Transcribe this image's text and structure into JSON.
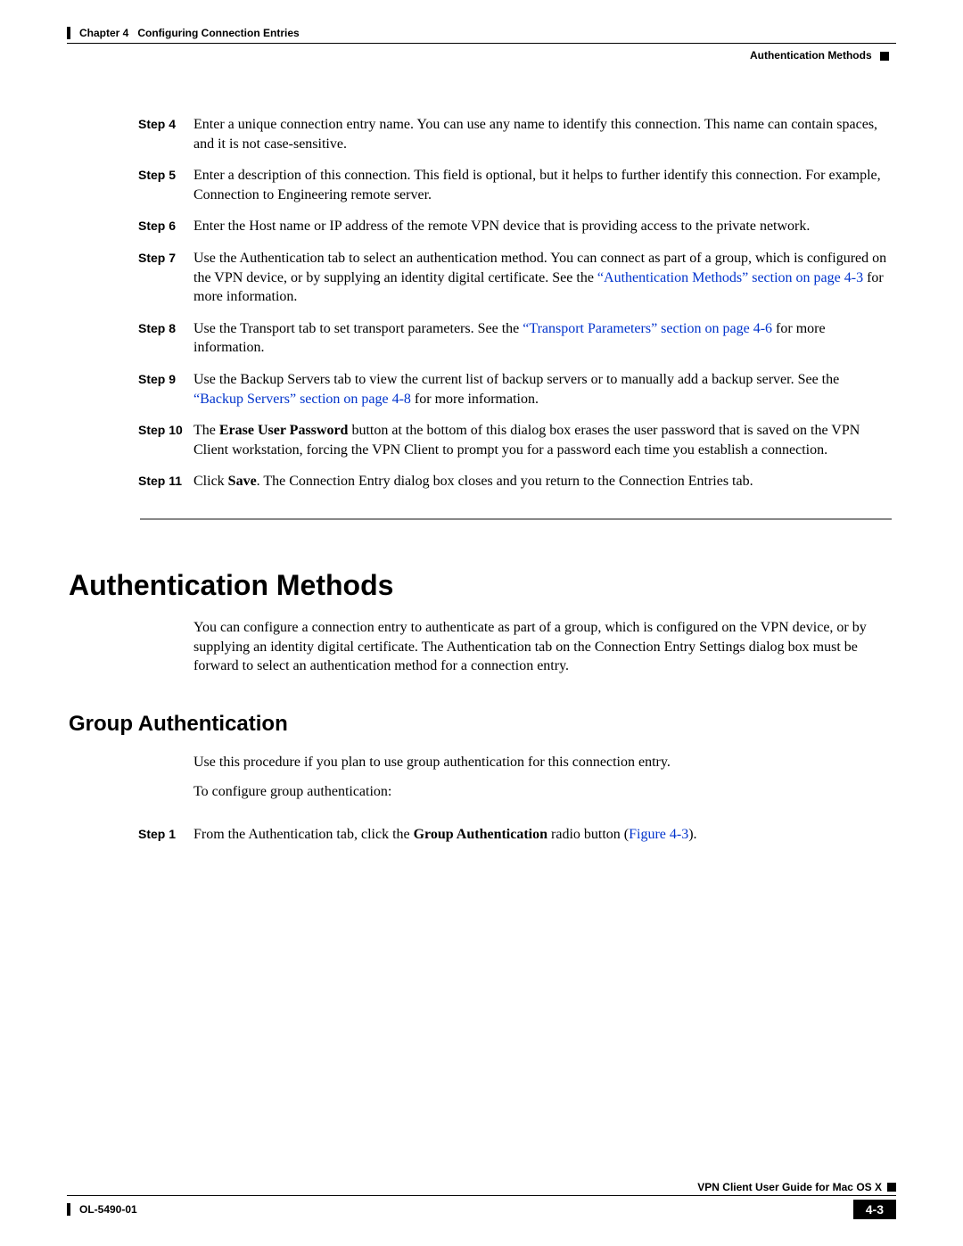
{
  "header": {
    "chapter": "Chapter 4",
    "title": "Configuring Connection Entries",
    "section": "Authentication Methods"
  },
  "steps_top": [
    {
      "label": "Step 4",
      "segments": [
        {
          "t": "Enter a unique connection entry name. You can use any name to identify this connection. This name can contain spaces, and it is not case-sensitive."
        }
      ]
    },
    {
      "label": "Step 5",
      "segments": [
        {
          "t": "Enter a description of this connection. This field is optional, but it helps to further identify this connection. For example, Connection to Engineering remote server."
        }
      ]
    },
    {
      "label": "Step 6",
      "segments": [
        {
          "t": "Enter the Host name or IP address of the remote VPN device that is providing access to the private network."
        }
      ]
    },
    {
      "label": "Step 7",
      "segments": [
        {
          "t": "Use the Authentication tab to select an authentication method. You can connect as part of a group, which is configured on the VPN device, or by supplying an identity digital certificate. See the "
        },
        {
          "t": "“Authentication Methods” section on page 4-3",
          "link": true
        },
        {
          "t": " for more information."
        }
      ]
    },
    {
      "label": "Step 8",
      "segments": [
        {
          "t": "Use the Transport tab to set transport parameters. See the "
        },
        {
          "t": "“Transport Parameters” section on page 4-6",
          "link": true
        },
        {
          "t": " for more information."
        }
      ]
    },
    {
      "label": "Step 9",
      "segments": [
        {
          "t": "Use the Backup Servers tab to view the current list of backup servers or to manually add a backup server. See the "
        },
        {
          "t": "“Backup Servers” section on page 4-8",
          "link": true
        },
        {
          "t": " for more information."
        }
      ]
    },
    {
      "label": "Step 10",
      "segments": [
        {
          "t": "The "
        },
        {
          "t": "Erase User Password",
          "bold": true
        },
        {
          "t": " button at the bottom of this dialog box erases the user password that is saved on the VPN Client workstation, forcing the VPN Client to prompt you for a password each time you establish a connection."
        }
      ]
    },
    {
      "label": "Step 11",
      "segments": [
        {
          "t": "Click "
        },
        {
          "t": "Save",
          "bold": true
        },
        {
          "t": ". The Connection Entry dialog box closes and you return to the Connection Entries tab."
        }
      ]
    }
  ],
  "section1": {
    "heading": "Authentication Methods",
    "para": "You can configure a connection entry to authenticate as part of a group, which is configured on the VPN device, or by supplying an identity digital certificate. The Authentication tab on the Connection Entry Settings dialog box must be forward to select an authentication method for a connection entry."
  },
  "section2": {
    "heading": "Group Authentication",
    "para1": "Use this procedure if you plan to use group authentication for this connection entry.",
    "para2": "To configure group authentication:"
  },
  "steps_bottom": [
    {
      "label": "Step 1",
      "segments": [
        {
          "t": "From the Authentication tab, click the "
        },
        {
          "t": "Group Authentication",
          "bold": true
        },
        {
          "t": " radio button ("
        },
        {
          "t": "Figure 4-3",
          "link": true
        },
        {
          "t": ")."
        }
      ]
    }
  ],
  "footer": {
    "guide": "VPN Client User Guide for Mac OS X",
    "doc": "OL-5490-01",
    "page": "4-3"
  }
}
